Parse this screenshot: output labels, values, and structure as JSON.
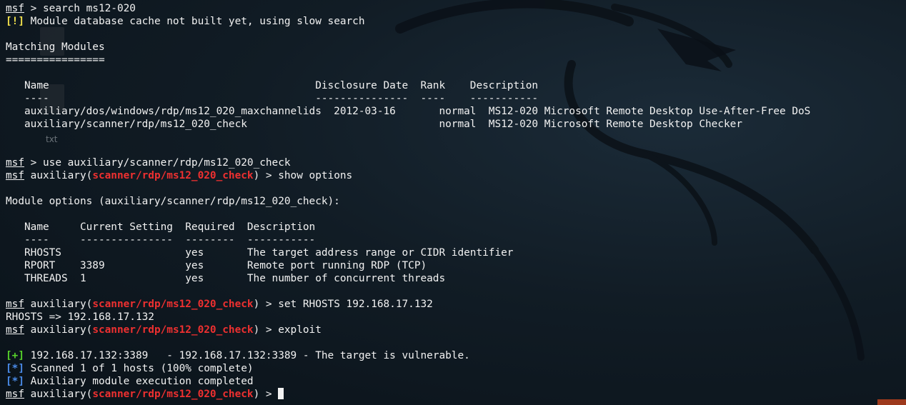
{
  "desktop": {
    "file_label": "txt"
  },
  "terminal": {
    "prompt": "msf",
    "cmd_search": " > search ms12-020",
    "warn_tag": "[!]",
    "warn_text": " Module database cache not built yet, using slow search",
    "matching_title": "Matching Modules",
    "matching_underline": "================",
    "search_table": {
      "header": "   Name                                           Disclosure Date  Rank    Description",
      "divider": "   ----                                           ---------------  ----    -----------",
      "rows": [
        "   auxiliary/dos/windows/rdp/ms12_020_maxchannelids  2012-03-16       normal  MS12-020 Microsoft Remote Desktop Use-After-Free DoS",
        "   auxiliary/scanner/rdp/ms12_020_check                               normal  MS12-020 Microsoft Remote Desktop Checker"
      ]
    },
    "cmd_use": " > use auxiliary/scanner/rdp/ms12_020_check",
    "aux_open": " auxiliary(",
    "module_path": "scanner/rdp/ms12_020_check",
    "cmd_show": ") > show options",
    "options_title": "Module options (auxiliary/scanner/rdp/ms12_020_check):",
    "options_table": {
      "header": "   Name     Current Setting  Required  Description",
      "divider": "   ----     ---------------  --------  -----------",
      "rows": [
        "   RHOSTS                    yes       The target address range or CIDR identifier",
        "   RPORT    3389             yes       Remote port running RDP (TCP)",
        "   THREADS  1                yes       The number of concurrent threads"
      ]
    },
    "cmd_set": ") > set RHOSTS 192.168.17.132",
    "set_result": "RHOSTS => 192.168.17.132",
    "cmd_exploit": ") > exploit",
    "good_tag": "[+]",
    "good_text": " 192.168.17.132:3389   - 192.168.17.132:3389 - The target is vulnerable.",
    "info_tag": "[*]",
    "info_text_1": " Scanned 1 of 1 hosts (100% complete)",
    "info_text_2": " Auxiliary module execution completed",
    "cmd_final": ") > "
  }
}
